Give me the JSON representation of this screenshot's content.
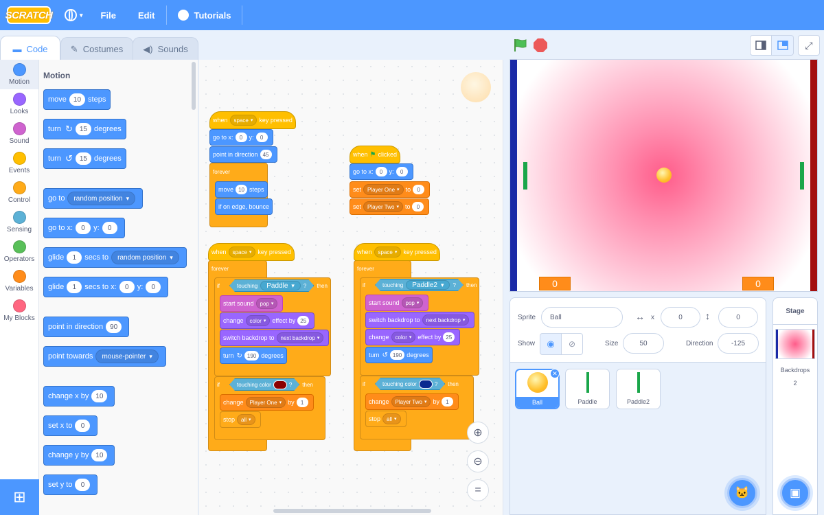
{
  "menubar": {
    "logo": "SCRATCH",
    "file": "File",
    "edit": "Edit",
    "tutorials": "Tutorials"
  },
  "tabs": {
    "code": "Code",
    "costumes": "Costumes",
    "sounds": "Sounds"
  },
  "categories": [
    "Motion",
    "Looks",
    "Sound",
    "Events",
    "Control",
    "Sensing",
    "Operators",
    "Variables",
    "My Blocks"
  ],
  "category_colors": [
    "#4c97ff",
    "#9966ff",
    "#cf63cf",
    "#ffbf00",
    "#ffab19",
    "#5cb1d6",
    "#59c059",
    "#ff8c1a",
    "#ff6680"
  ],
  "palette": {
    "title": "Motion",
    "move": {
      "a": "move",
      "n": "10",
      "b": "steps"
    },
    "turn_r": {
      "a": "turn",
      "n": "15",
      "b": "degrees"
    },
    "turn_l": {
      "a": "turn",
      "n": "15",
      "b": "degrees"
    },
    "goto": {
      "a": "go to",
      "dd": "random position"
    },
    "gotoxy": {
      "a": "go to x:",
      "x": "0",
      "b": "y:",
      "y": "0"
    },
    "glide1": {
      "a": "glide",
      "n": "1",
      "b": "secs to",
      "dd": "random position"
    },
    "glide2": {
      "a": "glide",
      "n": "1",
      "b": "secs to x:",
      "x": "0",
      "c": "y:",
      "y": "0"
    },
    "pointdir": {
      "a": "point in direction",
      "n": "90"
    },
    "pointtowards": {
      "a": "point towards",
      "dd": "mouse-pointer"
    },
    "changex": {
      "a": "change x by",
      "n": "10"
    },
    "setx": {
      "a": "set x to",
      "n": "0"
    },
    "changey": {
      "a": "change y by",
      "n": "10"
    },
    "sety": {
      "a": "set y to",
      "n": "0"
    }
  },
  "scripts": {
    "s1": {
      "when": "when",
      "key": "space",
      "pressed": "key pressed",
      "goto": "go to x:",
      "x": "0",
      "y_lbl": "y:",
      "y": "0",
      "pointdir": "point in direction",
      "dir": "45",
      "forever": "forever",
      "move": "move",
      "steps_n": "10",
      "steps": "steps",
      "bounce": "if on edge, bounce"
    },
    "s2": {
      "when": "when",
      "clicked": "clicked",
      "goto": "go to x:",
      "x": "0",
      "y_lbl": "y:",
      "y": "0",
      "set": "set",
      "v1": "Player One",
      "to": "to",
      "v1n": "0",
      "v2": "Player Two",
      "v2n": "0"
    },
    "s3": {
      "when": "when",
      "key": "space",
      "pressed": "key pressed",
      "forever": "forever",
      "if": "if",
      "touching": "touching",
      "target": "Paddle",
      "q": "?",
      "then": "then",
      "startsound": "start sound",
      "sound": "pop",
      "change": "change",
      "effect": "color",
      "effectby": "effect by",
      "effectn": "25",
      "switch": "switch backdrop to",
      "backdrop": "next backdrop",
      "turn": "turn",
      "turnn": "190",
      "degrees": "degrees",
      "touchingcolor": "touching color",
      "chg2": "change",
      "var": "Player One",
      "by": "by",
      "byn": "1",
      "stop": "stop",
      "stopv": "all"
    },
    "s4": {
      "when": "when",
      "key": "space",
      "pressed": "key pressed",
      "forever": "forever",
      "if": "if",
      "touching": "touching",
      "target": "Paddle2",
      "q": "?",
      "then": "then",
      "startsound": "start sound",
      "sound": "pop",
      "switch": "switch backdrop to",
      "backdrop": "next backdrop",
      "change": "change",
      "effect": "color",
      "effectby": "effect by",
      "effectn": "25",
      "turn": "turn",
      "turnn": "190",
      "degrees": "degrees",
      "touchingcolor": "touching color",
      "chg2": "change",
      "var": "Player Two",
      "by": "by",
      "byn": "1",
      "stop": "stop",
      "stopv": "all"
    }
  },
  "stage": {
    "score_left": "0",
    "score_right": "0"
  },
  "sprite_info": {
    "sprite_label": "Sprite",
    "sprite_name": "Ball",
    "x_label": "x",
    "x": "0",
    "y_label": "y",
    "y": "0",
    "show_label": "Show",
    "size_label": "Size",
    "size": "50",
    "direction_label": "Direction",
    "direction": "-125"
  },
  "sprites": [
    "Ball",
    "Paddle",
    "Paddle2"
  ],
  "stage_target": {
    "title": "Stage",
    "backdrops_label": "Backdrops",
    "backdrops_count": "2"
  }
}
